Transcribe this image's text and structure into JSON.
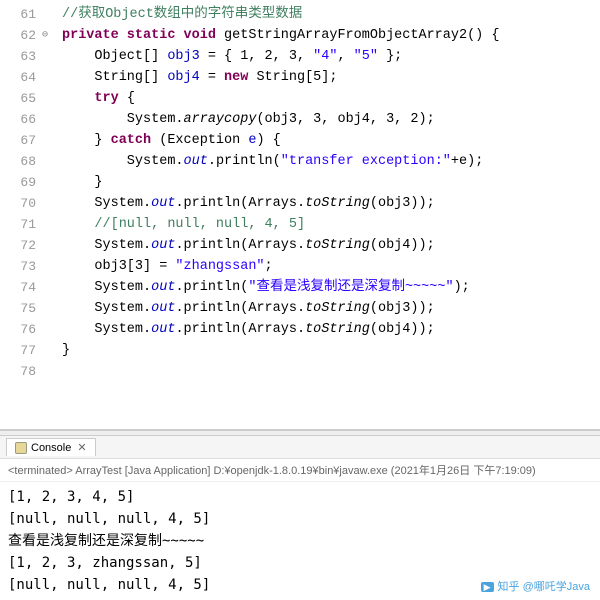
{
  "editor": {
    "lines": [
      {
        "n": 61,
        "fold": false
      },
      {
        "n": 62,
        "fold": true
      },
      {
        "n": 63,
        "fold": false
      },
      {
        "n": 64,
        "fold": false
      },
      {
        "n": 65,
        "fold": false
      },
      {
        "n": 66,
        "fold": false
      },
      {
        "n": 67,
        "fold": false
      },
      {
        "n": 68,
        "fold": false
      },
      {
        "n": 69,
        "fold": false
      },
      {
        "n": 70,
        "fold": false
      },
      {
        "n": 71,
        "fold": false
      },
      {
        "n": 72,
        "fold": false
      },
      {
        "n": 73,
        "fold": false
      },
      {
        "n": 74,
        "fold": false
      },
      {
        "n": 75,
        "fold": false
      },
      {
        "n": 76,
        "fold": false
      },
      {
        "n": 77,
        "fold": false
      },
      {
        "n": 78,
        "fold": false
      }
    ],
    "code": {
      "l61_comment": "//获取Object数组中的字符串类型数据",
      "l62_kw1": "private static void",
      "l62_name": " getStringArrayFromObjectArray2() {",
      "l63_a": "    Object[] ",
      "l63_var": "obj3",
      "l63_b": " = { 1, 2, 3, ",
      "l63_s1": "\"4\"",
      "l63_c": ", ",
      "l63_s2": "\"5\"",
      "l63_d": " };",
      "l64_a": "    String[] ",
      "l64_var": "obj4",
      "l64_b": " = ",
      "l64_kw": "new",
      "l64_c": " String[5];",
      "l65_kw": "try",
      "l65_b": " {",
      "l66_a": "        System.",
      "l66_m": "arraycopy",
      "l66_b": "(obj3, 3, obj4, 3, 2);",
      "l67_a": "    } ",
      "l67_kw": "catch",
      "l67_b": " (Exception ",
      "l67_var": "e",
      "l67_c": ") {",
      "l68_a": "        System.",
      "l68_f": "out",
      "l68_b": ".println(",
      "l68_s": "\"transfer exception:\"",
      "l68_c": "+e);",
      "l69": "    }",
      "l70_a": "    System.",
      "l70_f": "out",
      "l70_b": ".println(Arrays.",
      "l70_m": "toString",
      "l70_c": "(obj3));",
      "l71_comment": "    //[null, null, null, 4, 5]",
      "l72_a": "    System.",
      "l72_f": "out",
      "l72_b": ".println(Arrays.",
      "l72_m": "toString",
      "l72_c": "(obj4));",
      "l73_a": "    obj3[3] = ",
      "l73_s": "\"zhangssan\"",
      "l73_b": ";",
      "l74_a": "    System.",
      "l74_f": "out",
      "l74_b": ".println(",
      "l74_s": "\"查看是浅复制还是深复制~~~~~\"",
      "l74_c": ");",
      "l75_a": "    System.",
      "l75_f": "out",
      "l75_b": ".println(Arrays.",
      "l75_m": "toString",
      "l75_c": "(obj3));",
      "l76_a": "    System.",
      "l76_f": "out",
      "l76_b": ".println(Arrays.",
      "l76_m": "toString",
      "l76_c": "(obj4));",
      "l77": "}"
    }
  },
  "console": {
    "tab_label": "Console",
    "meta": "<terminated> ArrayTest [Java Application] D:¥openjdk-1.8.0.19¥bin¥javaw.exe (2021年1月26日 下午7:19:09)",
    "out": [
      "[1, 2, 3, 4, 5]",
      "[null, null, null, 4, 5]",
      "查看是浅复制还是深复制~~~~~",
      "[1, 2, 3, zhangssan, 5]",
      "[null, null, null, 4, 5]"
    ]
  },
  "watermark": "知乎 @哪吒学Java"
}
